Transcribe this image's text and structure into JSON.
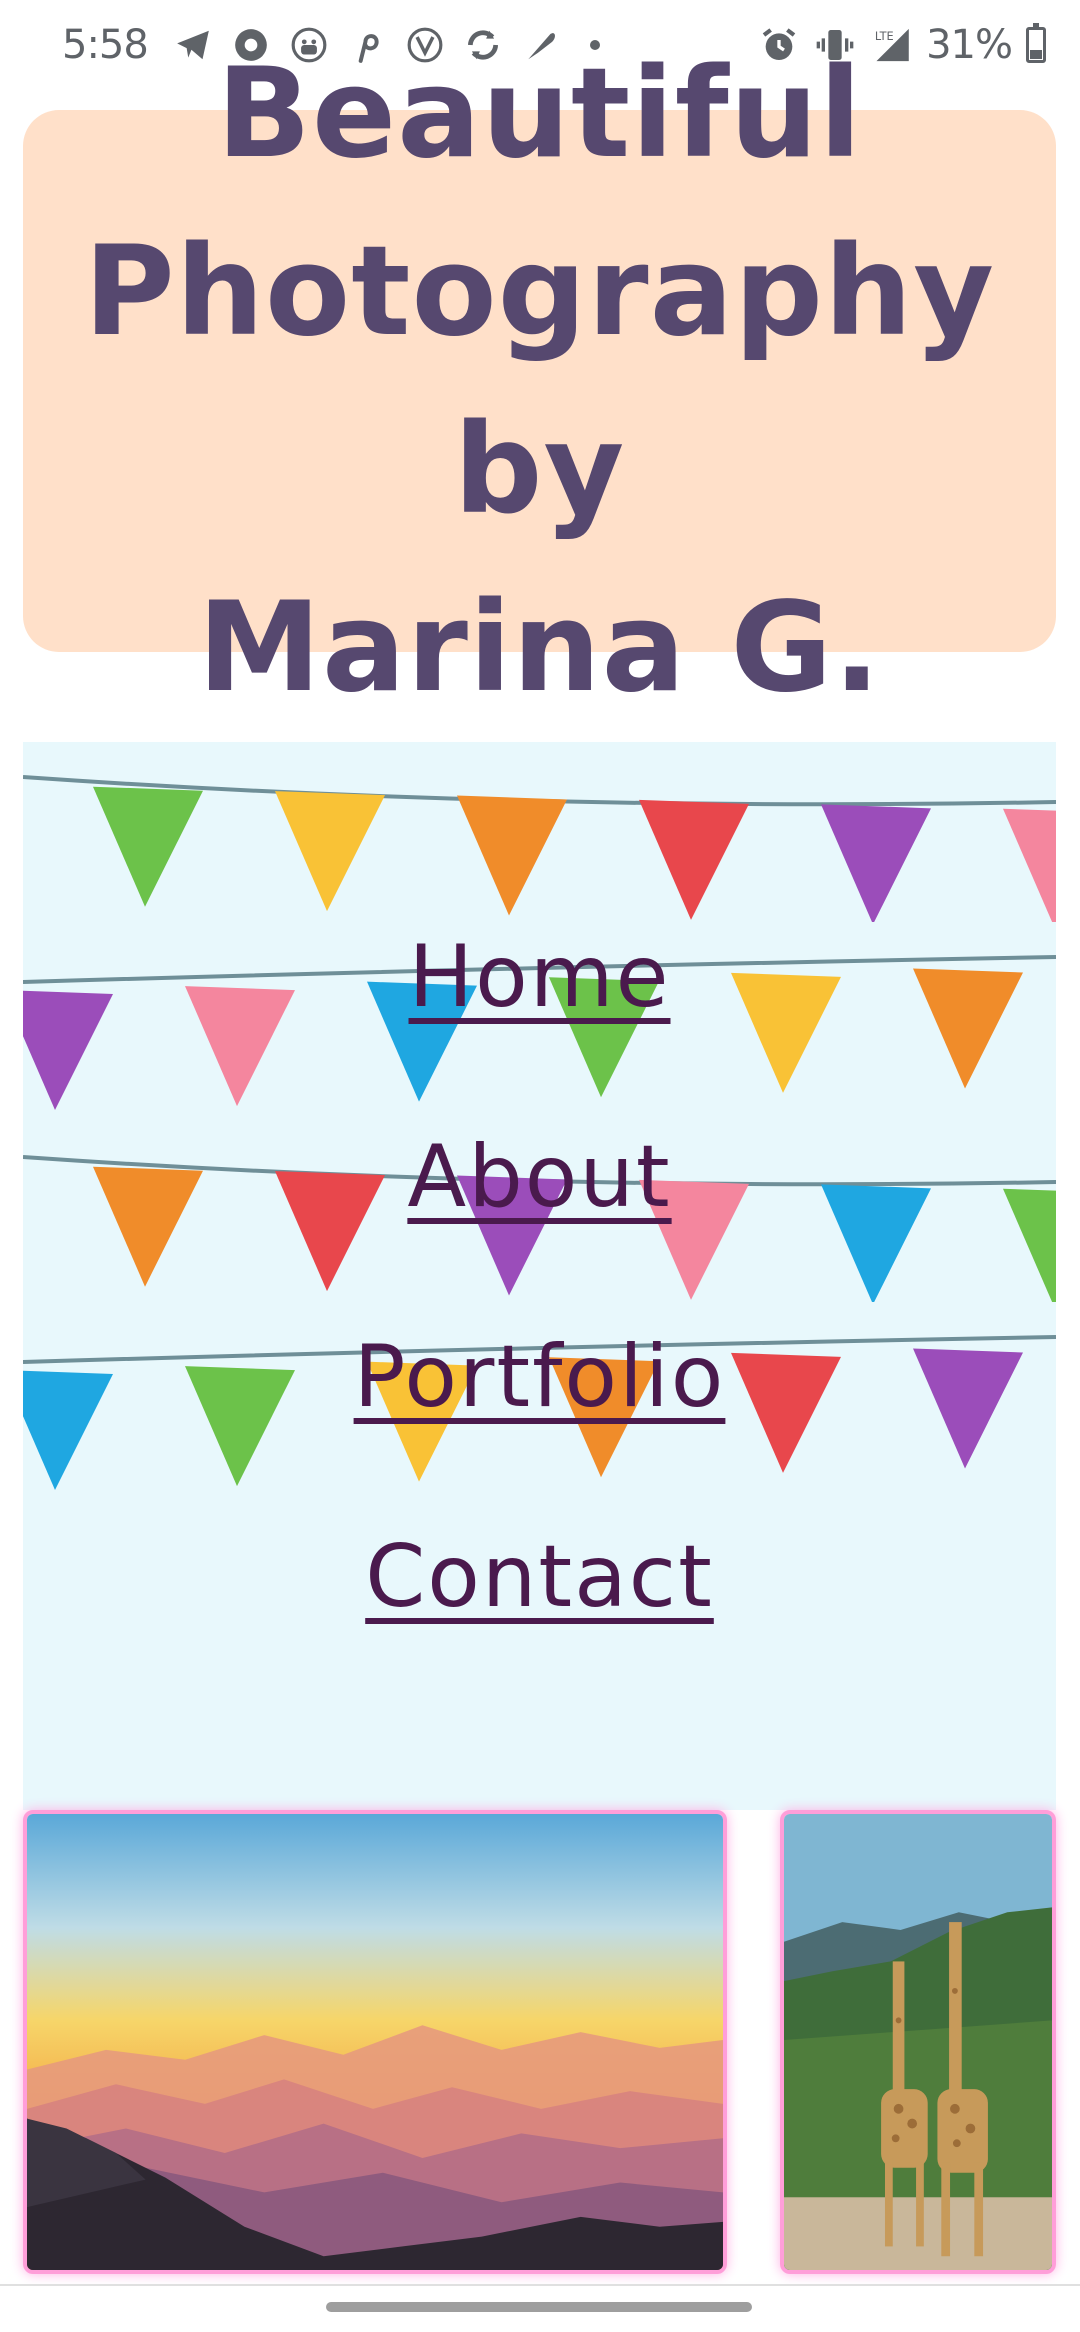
{
  "status_bar": {
    "time": "5:58",
    "left_icons": [
      "telegram-icon",
      "record-icon",
      "avatar-icon",
      "pinterest-icon",
      "vpn-icon",
      "sync-icon",
      "feather-icon",
      "dot-icon"
    ],
    "right_icons": [
      "alarm-icon",
      "vibrate-icon",
      "lte-signal-icon",
      "battery-icon"
    ],
    "network": "LTE",
    "battery_percent": "31%"
  },
  "header": {
    "title_line1": "Beautiful",
    "title_line2": "Photography by",
    "title_line3": "Marina G.",
    "background_color": "#ffe0c9",
    "text_color": "#56486f"
  },
  "nav": {
    "background_color": "#e8f8fc",
    "link_color": "#4a1a4d",
    "links": [
      {
        "label": "Home"
      },
      {
        "label": "About"
      },
      {
        "label": "Portfolio"
      },
      {
        "label": "Contact"
      }
    ],
    "bunting_colors": [
      "#6cc24a",
      "#f9c236",
      "#f08c2a",
      "#e8474c",
      "#9b4dba",
      "#f4869e",
      "#1fa7e1"
    ]
  },
  "gallery": {
    "border_color": "#ff9ed9",
    "photos": [
      {
        "subject": "sunset-mountains"
      },
      {
        "subject": "giraffes"
      }
    ]
  }
}
